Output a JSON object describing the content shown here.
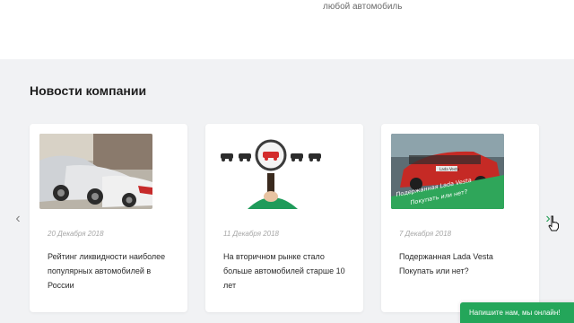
{
  "top": {
    "caption": "любой автомобиль"
  },
  "section": {
    "title": "Новости компании"
  },
  "news": [
    {
      "date": "20 Декабря 2018",
      "title": "Рейтинг ликвидности наиболее популярных автомобилей в России",
      "image_icon": "cars-row-image"
    },
    {
      "date": "11 Декабря 2018",
      "title": "На вторичном рынке стало больше автомобилей старше 10 лет",
      "image_icon": "magnifier-car-image"
    },
    {
      "date": "7 Декабря 2018",
      "title": "Подержанная Lada Vesta Покупать или нет?",
      "image_icon": "lada-vesta-image",
      "image_text": {
        "badge": "Lada Vesta",
        "line1": "Подержанная Lada Vesta",
        "line2": "Покупать или нет?"
      }
    }
  ],
  "navigation": {
    "prev_icon": "chevron-left-icon",
    "next_icon": "chevron-right-icon"
  },
  "chat": {
    "label": "Напишите нам, мы онлайн!"
  },
  "colors": {
    "accent": "#24a65a",
    "background": "#f1f2f4",
    "card": "#ffffff"
  }
}
